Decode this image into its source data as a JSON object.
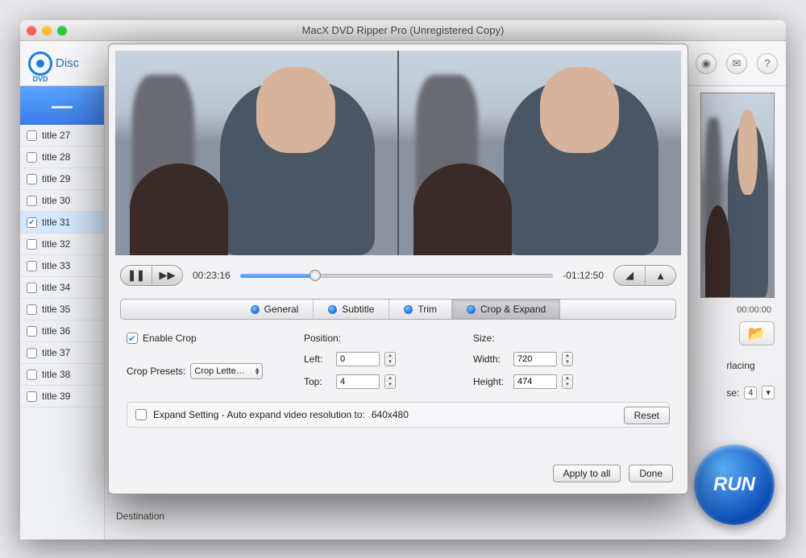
{
  "window": {
    "title": "MacX DVD Ripper Pro (Unregistered Copy)"
  },
  "logo": {
    "text": "Disc",
    "sub": "DVD"
  },
  "sidebar": {
    "collapse_glyph": "—",
    "titles": [
      {
        "label": "title 27",
        "checked": false
      },
      {
        "label": "title 28",
        "checked": false
      },
      {
        "label": "title 29",
        "checked": false
      },
      {
        "label": "title 30",
        "checked": false
      },
      {
        "label": "title 31",
        "checked": true
      },
      {
        "label": "title 32",
        "checked": false
      },
      {
        "label": "title 33",
        "checked": false
      },
      {
        "label": "title 34",
        "checked": false
      },
      {
        "label": "title 35",
        "checked": false
      },
      {
        "label": "title 36",
        "checked": false
      },
      {
        "label": "title 37",
        "checked": false
      },
      {
        "label": "title 38",
        "checked": false
      },
      {
        "label": "title 39",
        "checked": false
      }
    ]
  },
  "right_panel": {
    "time": "00:00:00",
    "opt1": "rlacing",
    "opt2_label": "se:",
    "opt2_value": "4"
  },
  "run_label": "RUN",
  "destination_label": "Destination",
  "transport": {
    "elapsed": "00:23:16",
    "remaining": "-01:12:50",
    "progress_pct": 24
  },
  "tabs": {
    "items": [
      "General",
      "Subtitle",
      "Trim",
      "Crop & Expand"
    ],
    "active_index": 3
  },
  "crop": {
    "enable_label": "Enable Crop",
    "enable_checked": true,
    "presets_label": "Crop Presets:",
    "presets_value": "Crop Lette…",
    "position_label": "Position:",
    "left_label": "Left:",
    "left_value": "0",
    "top_label": "Top:",
    "top_value": "4",
    "size_label": "Size:",
    "width_label": "Width:",
    "width_value": "720",
    "height_label": "Height:",
    "height_value": "474",
    "expand_label": "Expand Setting - Auto expand video resolution to:",
    "expand_value": "640x480",
    "expand_checked": false,
    "reset_label": "Reset"
  },
  "footer": {
    "apply_all": "Apply to all",
    "done": "Done"
  }
}
